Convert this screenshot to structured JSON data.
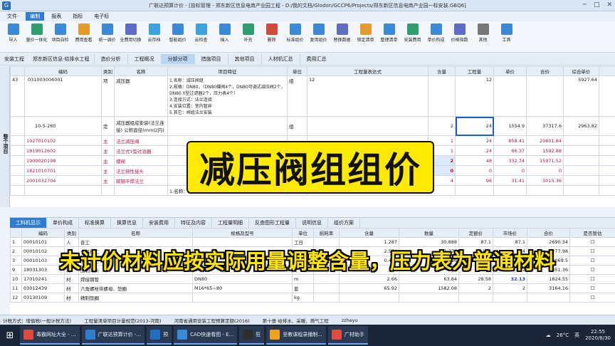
{
  "window": {
    "title": "广联达预算计价 - [投标管理 - 郑东新区信息电商产业园工程 - D:/我的文档/Glodon/GCCP6/Projects/郑东新区信息电商产业园一标安装.GBQ6]"
  },
  "menu": {
    "items": [
      "文件·",
      "编制",
      "报表",
      "指标",
      "电子标"
    ],
    "active_index": 1
  },
  "toolbar": {
    "buttons": [
      {
        "label": "导入",
        "color": "#3b8ad9"
      },
      {
        "label": "量价一体化",
        "color": "#2f9e6e"
      },
      {
        "label": "项目自检",
        "color": "#3b8ad9"
      },
      {
        "label": "费用查看",
        "color": "#e39b2f"
      },
      {
        "label": "统一调价",
        "color": "#3b8ad9"
      },
      {
        "label": "全费用切换",
        "color": "#5d6cc7"
      },
      {
        "label": "云存档",
        "color": "#3aa3e0"
      },
      {
        "label": "智能组价",
        "color": "#3b8ad9"
      },
      {
        "label": "云检查",
        "color": "#3aa3e0"
      },
      {
        "label": "插入",
        "color": "#3b8ad9"
      },
      {
        "label": "补充",
        "color": "#2f9e6e"
      },
      {
        "label": "删除",
        "color": "#d14a3b"
      },
      {
        "label": "标准组价",
        "color": "#3b8ad9"
      },
      {
        "label": "复用组价",
        "color": "#3b8ad9"
      },
      {
        "label": "替换数据",
        "color": "#5d6cc7"
      },
      {
        "label": "锁定清单",
        "color": "#e39b2f"
      },
      {
        "label": "整理清单",
        "color": "#3b8ad9"
      },
      {
        "label": "安装费用",
        "color": "#2f9e6e"
      },
      {
        "label": "单价构成",
        "color": "#3b8ad9"
      },
      {
        "label": "价格指数",
        "color": "#5d6cc7"
      },
      {
        "label": "其他",
        "color": "#777777"
      },
      {
        "label": "工具",
        "color": "#3b8ad9"
      }
    ]
  },
  "pathbar": {
    "crumbs": [
      "安装工程",
      "郑东新区信息-给排水工程"
    ],
    "tabs": [
      "造价分析",
      "工程概况",
      "分部分项",
      "措施项目",
      "其他项目",
      "人材机汇总",
      "费用汇总"
    ],
    "active_tab_index": 2
  },
  "sidebar": {
    "label": "整个项目"
  },
  "main_grid": {
    "headers": [
      "",
      "编码",
      "类别",
      "名称",
      "项目特征",
      "单位",
      "工程量表达式",
      "含量",
      "工程量",
      "单价",
      "合价",
      "综合单价"
    ],
    "rows": [
      {
        "no": "43",
        "code": "031003006001",
        "type": "项",
        "name": "减压器",
        "feature": "1.名称：减压阀组\n2.规格：DN80，（DN80蝶阀4个，DN80可调式减压阀2个，DN80 Y型过滤器2个，压力表4个）\n3.连接方式：法兰连接\n4.安装位置：室内管井\n5.其它：阀组法兰安装",
        "unit": "组",
        "expr": "12",
        "content": "",
        "qty": "12",
        "price": "",
        "total": "",
        "composite": "5927.64",
        "kind": "item"
      },
      {
        "no": "",
        "code": "10-5-260",
        "type": "定",
        "name": "减压器组成安装(法兰连接) 公称直径(mm以内)",
        "feature": "",
        "unit": "组",
        "expr": "",
        "content": "2",
        "qty": "24",
        "price": "1554.9",
        "total": "37317.6",
        "composite": "2963.82",
        "kind": "quota"
      },
      {
        "no": "",
        "code": "1927010102",
        "type": "主",
        "name": "法兰减压阀",
        "feature": "",
        "unit": "",
        "expr": "",
        "content": "1",
        "qty": "24",
        "price": "858.41",
        "total": "20601.84",
        "composite": "",
        "kind": "mat"
      },
      {
        "no": "",
        "code": "1819012602",
        "type": "主",
        "name": "法兰式Y型过滤器",
        "feature": "",
        "unit": "",
        "expr": "",
        "content": "1",
        "qty": "24",
        "price": "66.37",
        "total": "1592.88",
        "composite": "",
        "kind": "mat"
      },
      {
        "no": "",
        "code": "1900020198",
        "type": "主",
        "name": "蝶阀",
        "feature": "",
        "unit": "",
        "expr": "",
        "content": "2",
        "qty": "48",
        "price": "332.74",
        "total": "15971.52",
        "composite": "",
        "kind": "mat-red"
      },
      {
        "no": "",
        "code": "1821010701",
        "type": "主",
        "name": "法兰挠性接头",
        "feature": "",
        "unit": "",
        "expr": "",
        "content": "0",
        "qty": "0",
        "price": "0",
        "total": "0",
        "composite": "",
        "kind": "mat-blue"
      },
      {
        "no": "",
        "code": "2001032704",
        "type": "主",
        "name": "碳钢平焊法兰",
        "feature": "",
        "unit": "片",
        "expr": "",
        "content": "4",
        "qty": "96",
        "price": "31.41",
        "total": "3015.36",
        "composite": "",
        "kind": "mat"
      },
      {
        "no": "",
        "code": "",
        "type": "",
        "name": "",
        "feature": "1.名称：减压...",
        "unit": "",
        "expr": "",
        "content": "",
        "qty": "",
        "price": "",
        "total": "",
        "composite": "",
        "kind": "blank"
      }
    ]
  },
  "lower_tabs": {
    "items": [
      "工料机显示",
      "单价构成",
      "标准换算",
      "换算信息",
      "安装费用",
      "特征及内容",
      "工程量明细",
      "反查图形工程量",
      "说明信息",
      "组价方案"
    ],
    "active_index": 0
  },
  "lower_grid": {
    "headers": [
      "",
      "编码",
      "类别",
      "名称",
      "规格及型号",
      "单位",
      "损耗率",
      "含量",
      "数量",
      "定额价",
      "市场价",
      "合价",
      "是否暂估"
    ],
    "rows": [
      {
        "no": "1",
        "code": "00010101",
        "type": "人",
        "name": "普工",
        "spec": "",
        "unit": "工日",
        "loss": "",
        "content": "1.287",
        "qty": "30.888",
        "base": "87.1",
        "market": "87.1",
        "total": "2690.34"
      },
      {
        "no": "2",
        "code": "00010102",
        "type": "人",
        "name": "一般技工",
        "spec": "",
        "unit": "工日",
        "loss": "",
        "content": "2.574",
        "qty": "61.776",
        "base": "134",
        "market": "134",
        "total": "8277.98"
      },
      {
        "no": "3",
        "code": "00010103",
        "type": "人",
        "name": "高级技工",
        "spec": "",
        "unit": "工日",
        "loss": "",
        "content": "0.429",
        "qty": "10.296",
        "base": "201",
        "market": "201",
        "total": "2069.5"
      },
      {
        "no": "9",
        "code": "18031303",
        "type": "材",
        "name": "压制弯头",
        "spec": "DN80",
        "unit": "个",
        "loss": "",
        "content": "2",
        "qty": "48",
        "base": "7.32",
        "market": "7.32",
        "total": "351.36"
      },
      {
        "no": "10",
        "code": "17010241",
        "type": "材",
        "name": "焊接钢管",
        "spec": "DN80",
        "unit": "m",
        "loss": "",
        "content": "2.66",
        "qty": "63.84",
        "base": "28.58",
        "market": "32.13",
        "total": "1824.55"
      },
      {
        "no": "11",
        "code": "03012439",
        "type": "材",
        "name": "六角螺栓带螺母、垫圈",
        "spec": "M16*65~80",
        "unit": "套",
        "loss": "",
        "content": "65.92",
        "qty": "1582.08",
        "base": "2",
        "market": "2",
        "total": "3164.16"
      },
      {
        "no": "12",
        "code": "03130109",
        "type": "材",
        "name": "精制垫圈",
        "spec": "",
        "unit": "kg",
        "loss": "",
        "content": "",
        "qty": "",
        "base": "",
        "market": "",
        "total": ""
      }
    ]
  },
  "overlays": {
    "title": "减压阀组组价",
    "subtitle": "未计价材料应按实际用量调整含量，压力表为普通材料"
  },
  "statusbar": {
    "items": [
      "计税方式：增值税(一般计税方法)",
      "工程量清单项目计量规范(2013-河南)",
      "河南省通用安装工程预算定额(2016)",
      "第十册 给排水、采暖、燃气工程",
      "zzheyu"
    ]
  },
  "taskbar": {
    "tasks": [
      {
        "label": "毒霸网址大全 - ...",
        "color": "#e24a3b"
      },
      {
        "label": "广联达预算计价 -...",
        "color": "#2d7dd2"
      },
      {
        "label": "预",
        "color": "#1f6fc2"
      },
      {
        "label": "CAD快速看图 - E...",
        "color": "#3b8ad9"
      },
      {
        "label": "狂",
        "color": "#2e2e2e"
      },
      {
        "label": "坚教课程录播制...",
        "color": "#f0a21a"
      },
      {
        "label": "广材助手",
        "color": "#e24a3b"
      }
    ],
    "weather": "26°C",
    "ime": "英",
    "time": "22:55",
    "date": "2020/8/30"
  }
}
